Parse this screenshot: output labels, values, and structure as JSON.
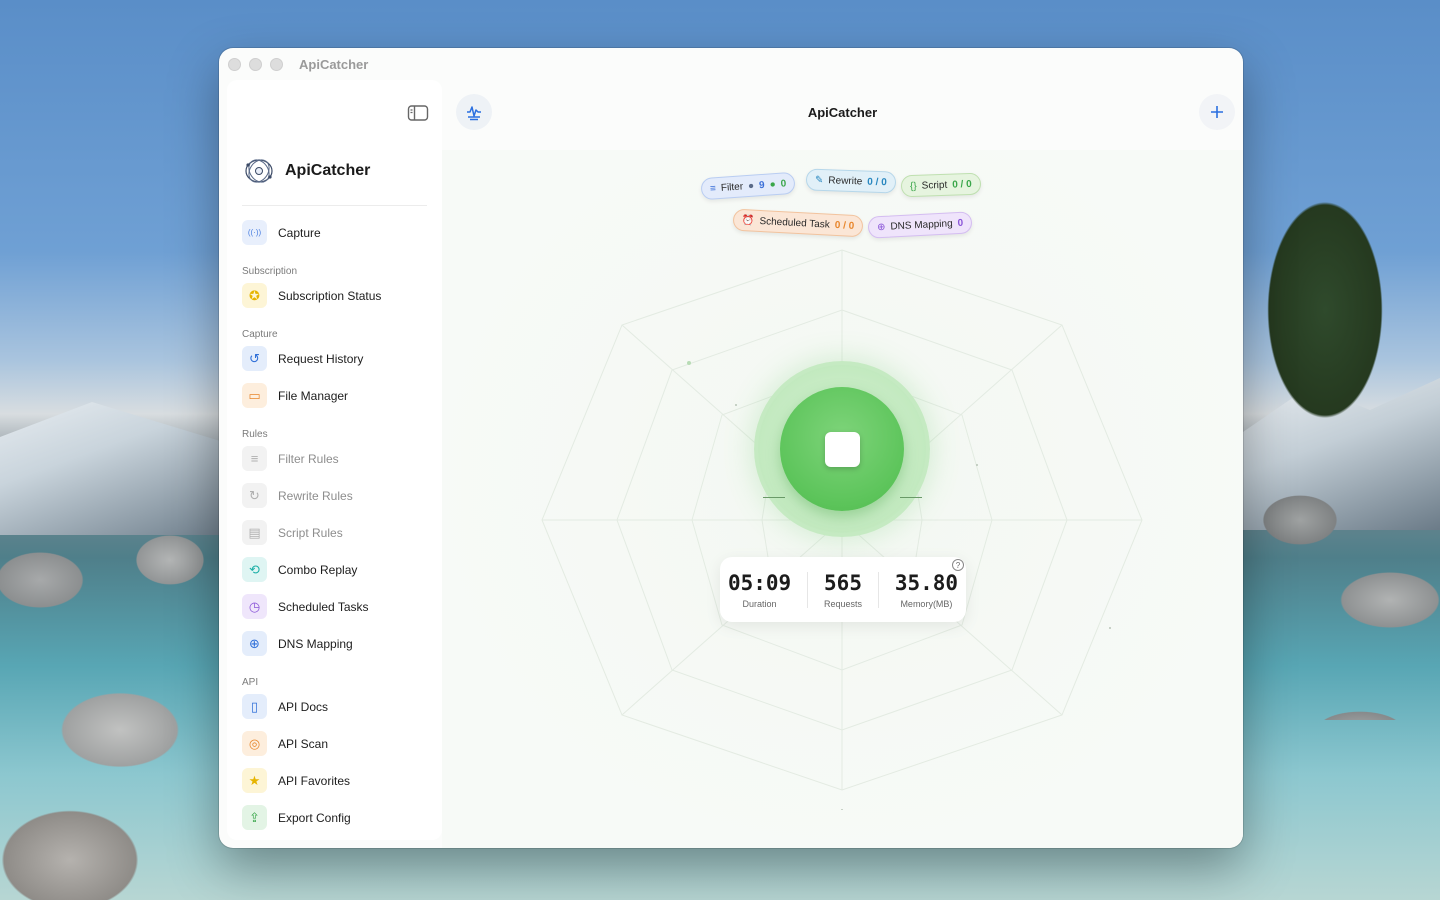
{
  "window": {
    "title": "ApiCatcher"
  },
  "sidebar": {
    "brand": "ApiCatcher",
    "items": [
      {
        "type": "item",
        "label": "Capture",
        "icon": "antenna-icon",
        "color": "#4a7fe0",
        "bg": "#e8effc",
        "disabled": false
      },
      {
        "type": "section",
        "label": "Subscription"
      },
      {
        "type": "item",
        "label": "Subscription Status",
        "icon": "star-badge-icon",
        "color": "#e6b400",
        "bg": "#fdf5d6",
        "disabled": false
      },
      {
        "type": "section",
        "label": "Capture"
      },
      {
        "type": "item",
        "label": "Request History",
        "icon": "history-icon",
        "color": "#2f6fd8",
        "bg": "#e4edfb",
        "disabled": false
      },
      {
        "type": "item",
        "label": "File Manager",
        "icon": "folder-icon",
        "color": "#e8872e",
        "bg": "#fdeedd",
        "disabled": false
      },
      {
        "type": "section",
        "label": "Rules"
      },
      {
        "type": "item",
        "label": "Filter Rules",
        "icon": "filter-icon",
        "color": "#b0b0b0",
        "bg": "#f2f2f2",
        "disabled": true
      },
      {
        "type": "item",
        "label": "Rewrite Rules",
        "icon": "refresh-icon",
        "color": "#b0b0b0",
        "bg": "#f2f2f2",
        "disabled": true
      },
      {
        "type": "item",
        "label": "Script Rules",
        "icon": "script-icon",
        "color": "#b0b0b0",
        "bg": "#f2f2f2",
        "disabled": true
      },
      {
        "type": "item",
        "label": "Combo Replay",
        "icon": "replay-icon",
        "color": "#1fb0a8",
        "bg": "#dff5f3",
        "disabled": false
      },
      {
        "type": "item",
        "label": "Scheduled Tasks",
        "icon": "timer-icon",
        "color": "#8a55d8",
        "bg": "#efe6fb",
        "disabled": false
      },
      {
        "type": "item",
        "label": "DNS Mapping",
        "icon": "globe-icon",
        "color": "#2f6fd8",
        "bg": "#e4edfb",
        "disabled": false
      },
      {
        "type": "section",
        "label": "API"
      },
      {
        "type": "item",
        "label": "API Docs",
        "icon": "document-icon",
        "color": "#2f6fd8",
        "bg": "#e4edfb",
        "disabled": false
      },
      {
        "type": "item",
        "label": "API Scan",
        "icon": "scan-icon",
        "color": "#e8872e",
        "bg": "#fdeedd",
        "disabled": false
      },
      {
        "type": "item",
        "label": "API Favorites",
        "icon": "star-icon",
        "color": "#e6b400",
        "bg": "#fdf5d6",
        "disabled": false
      },
      {
        "type": "item",
        "label": "Export Config",
        "icon": "export-icon",
        "color": "#3aa64a",
        "bg": "#e3f4e5",
        "disabled": false
      }
    ]
  },
  "main": {
    "title": "ApiCatcher",
    "chips": {
      "filter": {
        "label": "Filter",
        "a": "9",
        "b": "0"
      },
      "rewrite": {
        "label": "Rewrite",
        "value": "0 / 0"
      },
      "script": {
        "label": "Script",
        "value": "0 / 0"
      },
      "scheduled": {
        "label": "Scheduled Task",
        "value": "0 / 0"
      },
      "dns": {
        "label": "DNS Mapping",
        "value": "0"
      }
    },
    "stats": {
      "duration": {
        "value": "05:09",
        "label": "Duration"
      },
      "requests": {
        "value": "565",
        "label": "Requests"
      },
      "memory": {
        "value": "35.80",
        "label": "Memory(MB)"
      }
    },
    "help": "?"
  },
  "colors": {
    "accent": "#2a6fe0",
    "capture_green": "#5cc45a"
  }
}
